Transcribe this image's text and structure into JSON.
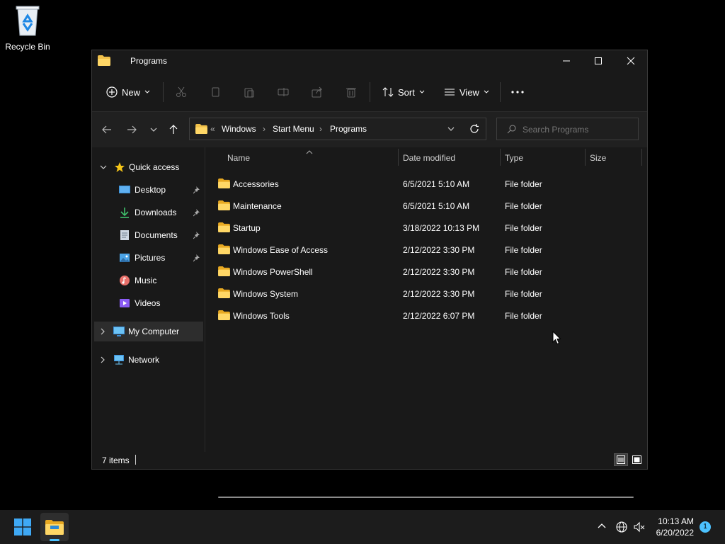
{
  "desktop": {
    "recycle_bin_label": "Recycle Bin"
  },
  "window": {
    "title": "Programs",
    "toolbar": {
      "new_label": "New",
      "sort_label": "Sort",
      "view_label": "View"
    },
    "address": {
      "overflow": "«",
      "crumbs": [
        "Windows",
        "Start Menu",
        "Programs"
      ]
    },
    "search": {
      "placeholder": "Search Programs"
    },
    "nav": {
      "quick_access": "Quick access",
      "desktop": "Desktop",
      "downloads": "Downloads",
      "documents": "Documents",
      "pictures": "Pictures",
      "music": "Music",
      "videos": "Videos",
      "my_computer": "My Computer",
      "network": "Network"
    },
    "columns": {
      "name": "Name",
      "date": "Date modified",
      "type": "Type",
      "size": "Size"
    },
    "files": [
      {
        "name": "Accessories",
        "date": "6/5/2021 5:10 AM",
        "type": "File folder"
      },
      {
        "name": "Maintenance",
        "date": "6/5/2021 5:10 AM",
        "type": "File folder"
      },
      {
        "name": "Startup",
        "date": "3/18/2022 10:13 PM",
        "type": "File folder"
      },
      {
        "name": "Windows Ease of Access",
        "date": "2/12/2022 3:30 PM",
        "type": "File folder"
      },
      {
        "name": "Windows PowerShell",
        "date": "2/12/2022 3:30 PM",
        "type": "File folder"
      },
      {
        "name": "Windows System",
        "date": "2/12/2022 3:30 PM",
        "type": "File folder"
      },
      {
        "name": "Windows Tools",
        "date": "2/12/2022 6:07 PM",
        "type": "File folder"
      }
    ],
    "status": {
      "item_count": "7 items"
    }
  },
  "taskbar": {
    "time": "10:13 AM",
    "date": "6/20/2022",
    "notification_count": "1"
  },
  "colors": {
    "folder": "#f0c04a",
    "accent": "#4cc2ff",
    "window_bg": "#191919"
  }
}
